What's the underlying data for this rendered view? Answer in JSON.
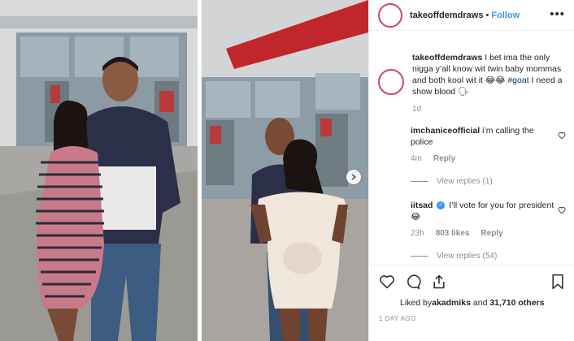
{
  "post": {
    "username": "takeoffdemdraws",
    "follow_label": "Follow",
    "more_label": "•••",
    "separator": "•",
    "caption_text": "I bet ima the only nigga y’all know wit twin baby mommas and both kool wit it 😂😂 ",
    "caption_hashtag": "#goat",
    "caption_tail": " I need a show blood 🗣",
    "caption_age": "1d"
  },
  "comments": [
    {
      "user": "imchaniceofficial",
      "text": "i’m calling the police",
      "age": "4m",
      "likes": "",
      "reply_label": "Reply",
      "view_replies": "View replies (1)"
    },
    {
      "user": "iitsad",
      "verified": true,
      "text": "I’ll vote for you for president 😂",
      "age": "23h",
      "likes": "803 likes",
      "reply_label": "Reply",
      "view_replies": "View replies (54)"
    }
  ],
  "engagement": {
    "liked_prefix": "Liked by ",
    "liked_user": "akadmiks",
    "liked_mid": " and ",
    "liked_count": "31,710 others",
    "time_ago": "1 DAY AGO"
  },
  "icons": {
    "heart": "heart-icon",
    "comment": "comment-icon",
    "share": "share-icon",
    "bookmark": "bookmark-icon",
    "next": "chevron-right-icon"
  },
  "colors": {
    "link_blue": "#3897f0",
    "hashtag": "#003569",
    "muted": "#8e8e8e",
    "story_ring": "#d43d7a"
  }
}
